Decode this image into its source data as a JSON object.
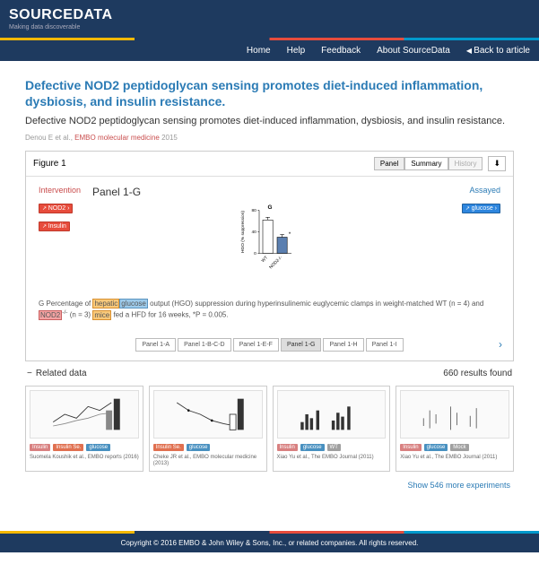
{
  "brand": {
    "name": "SOURCEDATA",
    "tagline": "Making data discoverable"
  },
  "nav": {
    "home": "Home",
    "help": "Help",
    "feedback": "Feedback",
    "about": "About SourceData",
    "back": "Back to article"
  },
  "article": {
    "title": "Defective NOD2 peptidoglycan sensing promotes diet-induced inflammation, dysbiosis, and insulin resistance.",
    "subtitle": "Defective NOD2 peptidoglycan sensing promotes diet-induced inflammation, dysbiosis, and insulin resistance.",
    "citation_prefix": "Denou E et al., ",
    "journal": "EMBO molecular medicine",
    "year": " 2015"
  },
  "figure": {
    "label": "Figure 1",
    "views": {
      "panel": "Panel",
      "summary": "Summary",
      "history": "History"
    },
    "panel_title": "Panel 1-G",
    "intervention_label": "Intervention",
    "assayed_label": "Assayed",
    "tags": {
      "nod2": "NOD2",
      "insulin": "Insulin",
      "glucose": "glucose"
    },
    "caption": {
      "p1a": "G Percentage of ",
      "hepatic": "hepatic",
      "glucose": "glucose",
      "p1b": " output (HGO) suppression during hyperinsulinemic euglycemic clamps in weight-matched WT (n = 4) and ",
      "nod2": "NOD2",
      "sup": "-/-",
      "p1c": " (n = 3) ",
      "mice": "mice",
      "p1d": " fed a HFD for 16 weeks, *P = 0.005."
    },
    "panel_tabs": [
      "Panel 1-A",
      "Panel 1-B-C-D",
      "Panel 1-E-F",
      "Panel 1-G",
      "Panel 1-H",
      "Panel 1-I"
    ],
    "active_tab": 3
  },
  "chart_data": {
    "type": "bar",
    "title": "G",
    "ylabel": "HGO (% suppression)",
    "categories": [
      "WT",
      "NOD2-/-"
    ],
    "values": [
      62,
      30
    ],
    "errors": [
      5,
      5
    ],
    "annotations": [
      "",
      "*"
    ],
    "ylim": [
      0,
      80
    ],
    "yticks": [
      0,
      40,
      80
    ]
  },
  "related": {
    "heading": "Related data",
    "count_text": "660 results found",
    "show_more": "Show 546 more experiments",
    "cards": [
      {
        "tags": [
          [
            "Insulin",
            "mt-pink"
          ],
          [
            "Insulin Se.",
            "mt-red"
          ],
          [
            "glucose",
            "mt-blue"
          ]
        ],
        "cite": "Suomela Koushik et al., EMBO reports (2016)"
      },
      {
        "tags": [
          [
            "Insulin Se.",
            "mt-red"
          ],
          [
            "glucose",
            "mt-blue"
          ]
        ],
        "cite": "Cheke JR et al., EMBO molecular medicine (2013)"
      },
      {
        "tags": [
          [
            "Insulin",
            "mt-pink"
          ],
          [
            "glucose",
            "mt-blue"
          ],
          [
            "WT",
            "mt-grey"
          ]
        ],
        "cite": "Xiao Yu et al., The EMBO Journal (2011)"
      },
      {
        "tags": [
          [
            "Insulin",
            "mt-pink"
          ],
          [
            "glucose",
            "mt-blue"
          ],
          [
            "Mock",
            "mt-grey"
          ]
        ],
        "cite": "Xiao Yu et al., The EMBO Journal (2011)"
      }
    ]
  },
  "footer": "Copyright © 2016 EMBO & John Wiley & Sons, Inc., or related companies. All rights reserved."
}
